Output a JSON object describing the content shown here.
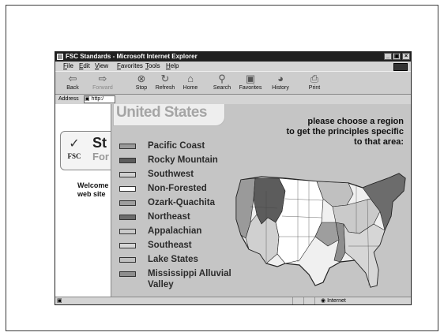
{
  "window": {
    "title": "FSC Standards - Microsoft Internet Explorer",
    "minimize": "_",
    "maximize": "1",
    "close": "×"
  },
  "menu": [
    "File",
    "Edit",
    "View",
    "Favorites",
    "Tools",
    "Help"
  ],
  "toolbar": {
    "back": "Back",
    "forward": "Forward",
    "stop": "Stop",
    "refresh": "Refresh",
    "home": "Home",
    "search": "Search",
    "favorites": "Favorites",
    "history": "History",
    "print": "Print"
  },
  "address": {
    "label": "Address",
    "value": "http:/"
  },
  "fsc": {
    "logo_text": "FSC",
    "title_fragment": "St",
    "subtitle_fragment": "For"
  },
  "welcome": "Welcome web site",
  "popup": {
    "title": "United States",
    "instruction_lines": [
      "please choose a region",
      "to get the principles specific",
      "to that area:"
    ],
    "regions": [
      {
        "label": "Pacific Coast",
        "color": "#9a9a9a"
      },
      {
        "label": "Rocky Mountain",
        "color": "#5c5c5c"
      },
      {
        "label": "Southwest",
        "color": "#d0d0d0"
      },
      {
        "label": "Non-Forested",
        "color": "#ffffff"
      },
      {
        "label": "Ozark-Quachita",
        "color": "#9e9e9e"
      },
      {
        "label": "Northeast",
        "color": "#6c6c6c"
      },
      {
        "label": "Appalachian",
        "color": "#cacaca"
      },
      {
        "label": "Southeast",
        "color": "#d6d6d6"
      },
      {
        "label": "Lake States",
        "color": "#c0c0c0"
      },
      {
        "label": "Mississippi Alluvial Valley",
        "color": "#8e8e8e"
      }
    ]
  },
  "status": {
    "zone": "Internet"
  }
}
